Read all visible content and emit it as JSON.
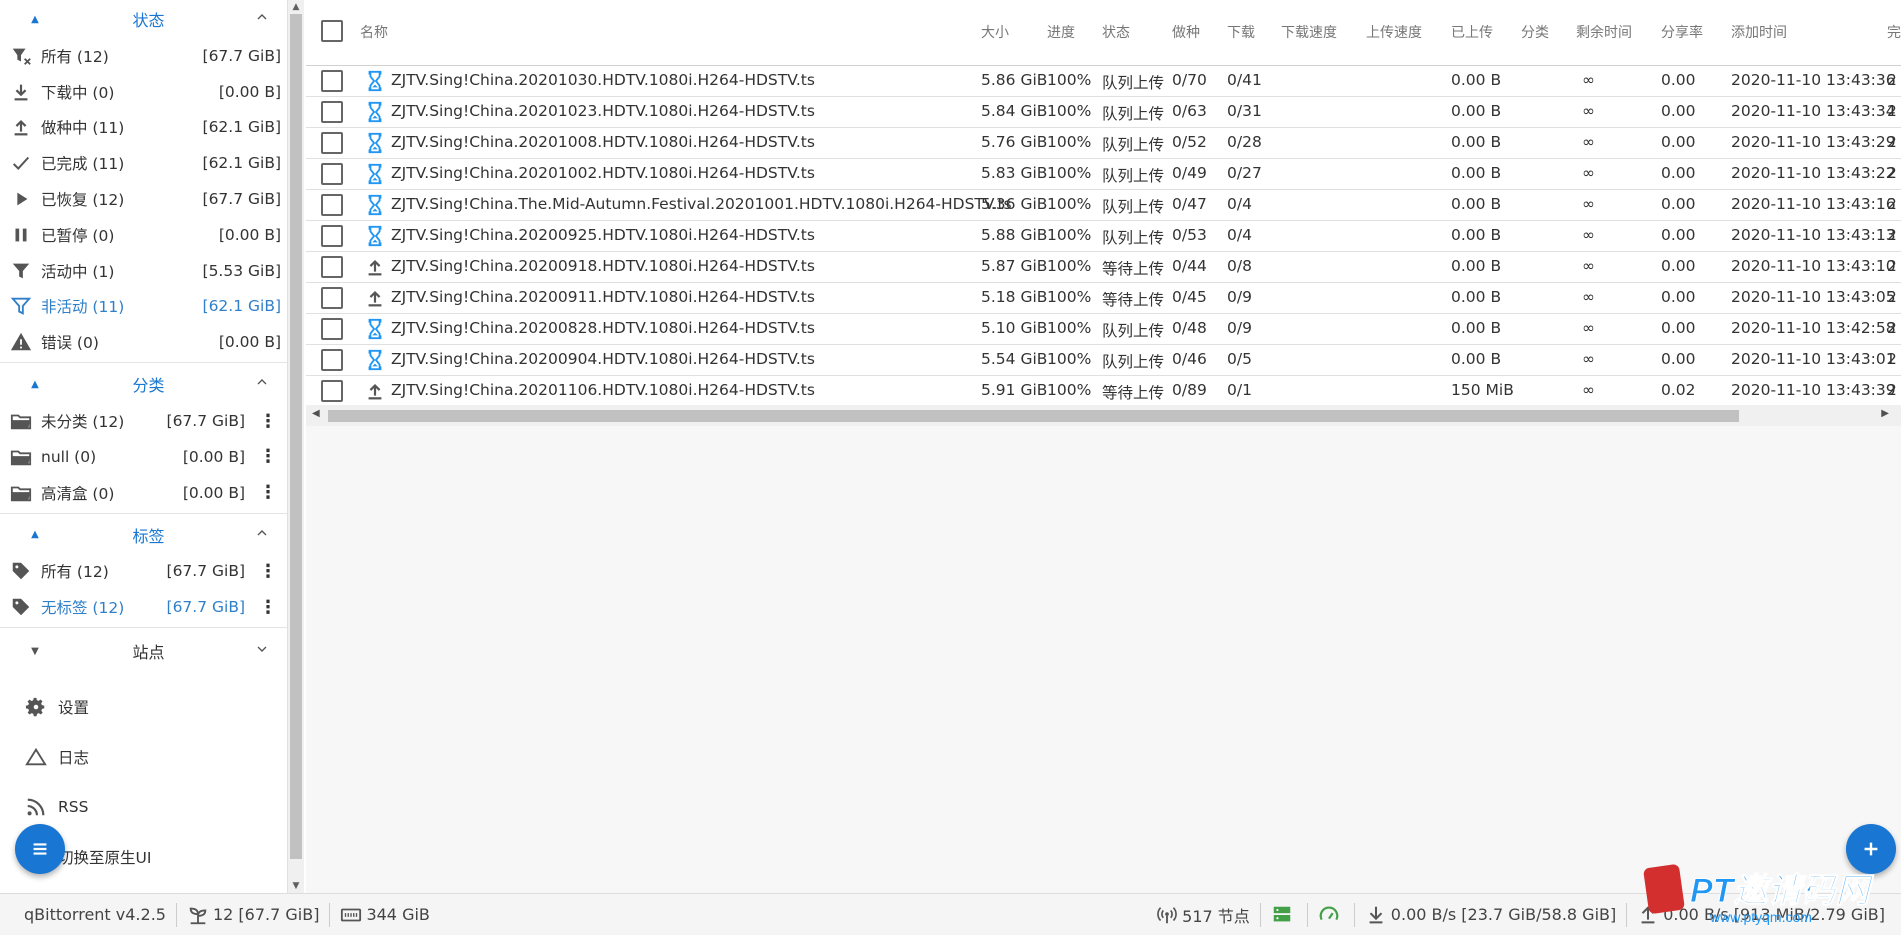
{
  "sidebar": {
    "status_section": {
      "title": "状态",
      "items": [
        {
          "label": "所有 (12)",
          "value": "[67.7 GiB]",
          "icon": "filter-x-icon"
        },
        {
          "label": "下载中 (0)",
          "value": "[0.00 B]",
          "icon": "download-icon"
        },
        {
          "label": "做种中 (11)",
          "value": "[62.1 GiB]",
          "icon": "upload-icon"
        },
        {
          "label": "已完成 (11)",
          "value": "[62.1 GiB]",
          "icon": "check-icon"
        },
        {
          "label": "已恢复 (12)",
          "value": "[67.7 GiB]",
          "icon": "play-icon"
        },
        {
          "label": "已暂停 (0)",
          "value": "[0.00 B]",
          "icon": "pause-icon"
        },
        {
          "label": "活动中 (1)",
          "value": "[5.53 GiB]",
          "icon": "filter-icon"
        },
        {
          "label": "非活动 (11)",
          "value": "[62.1 GiB]",
          "icon": "filter-outline-icon"
        },
        {
          "label": "错误 (0)",
          "value": "[0.00 B]",
          "icon": "alert-icon"
        }
      ]
    },
    "category_section": {
      "title": "分类",
      "items": [
        {
          "label": "未分类 (12)",
          "value": "[67.7 GiB]"
        },
        {
          "label": "null (0)",
          "value": "[0.00 B]"
        },
        {
          "label": "高清盒 (0)",
          "value": "[0.00 B]"
        }
      ]
    },
    "tag_section": {
      "title": "标签",
      "items": [
        {
          "label": "所有 (12)",
          "value": "[67.7 GiB]"
        },
        {
          "label": "无标签 (12)",
          "value": "[67.7 GiB]"
        }
      ]
    },
    "site_section": {
      "title": "站点"
    },
    "nav": [
      {
        "label": "设置",
        "icon": "gear-icon"
      },
      {
        "label": "日志",
        "icon": "triangle-icon"
      },
      {
        "label": "RSS",
        "icon": "rss-icon"
      },
      {
        "label": "切换至原生UI",
        "icon": "swap-icon"
      }
    ]
  },
  "table": {
    "headers": {
      "name": "名称",
      "size": "大小",
      "progress": "进度",
      "state": "状态",
      "seeds": "做种",
      "peers": "下载",
      "dl_speed": "下载速度",
      "up_speed": "上传速度",
      "uploaded": "已上传",
      "category": "分类",
      "eta": "剩余时间",
      "ratio": "分享率",
      "added": "添加时间",
      "more": "完"
    },
    "rows": [
      {
        "icon": "hourglass-icon",
        "name": "ZJTV.Sing!China.20201030.HDTV.1080i.H264-HDSTV.ts",
        "size": "5.86 GiB",
        "progress": "100%",
        "state": "队列上传",
        "seeds": "0/70",
        "peers": "0/41",
        "uploaded": "0.00 B",
        "eta": "∞",
        "ratio": "0.00",
        "added": "2020-11-10 13:43:36",
        "extra": "2"
      },
      {
        "icon": "hourglass-icon",
        "name": "ZJTV.Sing!China.20201023.HDTV.1080i.H264-HDSTV.ts",
        "size": "5.84 GiB",
        "progress": "100%",
        "state": "队列上传",
        "seeds": "0/63",
        "peers": "0/31",
        "uploaded": "0.00 B",
        "eta": "∞",
        "ratio": "0.00",
        "added": "2020-11-10 13:43:34",
        "extra": "2"
      },
      {
        "icon": "hourglass-icon",
        "name": "ZJTV.Sing!China.20201008.HDTV.1080i.H264-HDSTV.ts",
        "size": "5.76 GiB",
        "progress": "100%",
        "state": "队列上传",
        "seeds": "0/52",
        "peers": "0/28",
        "uploaded": "0.00 B",
        "eta": "∞",
        "ratio": "0.00",
        "added": "2020-11-10 13:43:29",
        "extra": "2"
      },
      {
        "icon": "hourglass-icon",
        "name": "ZJTV.Sing!China.20201002.HDTV.1080i.H264-HDSTV.ts",
        "size": "5.83 GiB",
        "progress": "100%",
        "state": "队列上传",
        "seeds": "0/49",
        "peers": "0/27",
        "uploaded": "0.00 B",
        "eta": "∞",
        "ratio": "0.00",
        "added": "2020-11-10 13:43:22",
        "extra": "2"
      },
      {
        "icon": "hourglass-icon",
        "name": "ZJTV.Sing!China.The.Mid-Autumn.Festival.20201001.HDTV.1080i.H264-HDSTV.ts",
        "size": "5.36 GiB",
        "progress": "100%",
        "state": "队列上传",
        "seeds": "0/47",
        "peers": "0/4",
        "uploaded": "0.00 B",
        "eta": "∞",
        "ratio": "0.00",
        "added": "2020-11-10 13:43:16",
        "extra": "2"
      },
      {
        "icon": "hourglass-icon",
        "name": "ZJTV.Sing!China.20200925.HDTV.1080i.H264-HDSTV.ts",
        "size": "5.88 GiB",
        "progress": "100%",
        "state": "队列上传",
        "seeds": "0/53",
        "peers": "0/4",
        "uploaded": "0.00 B",
        "eta": "∞",
        "ratio": "0.00",
        "added": "2020-11-10 13:43:13",
        "extra": "2"
      },
      {
        "icon": "upload-icon",
        "name": "ZJTV.Sing!China.20200918.HDTV.1080i.H264-HDSTV.ts",
        "size": "5.87 GiB",
        "progress": "100%",
        "state": "等待上传",
        "seeds": "0/44",
        "peers": "0/8",
        "uploaded": "0.00 B",
        "eta": "∞",
        "ratio": "0.00",
        "added": "2020-11-10 13:43:10",
        "extra": "2"
      },
      {
        "icon": "upload-icon",
        "name": "ZJTV.Sing!China.20200911.HDTV.1080i.H264-HDSTV.ts",
        "size": "5.18 GiB",
        "progress": "100%",
        "state": "等待上传",
        "seeds": "0/45",
        "peers": "0/9",
        "uploaded": "0.00 B",
        "eta": "∞",
        "ratio": "0.00",
        "added": "2020-11-10 13:43:05",
        "extra": "2"
      },
      {
        "icon": "hourglass-icon",
        "name": "ZJTV.Sing!China.20200828.HDTV.1080i.H264-HDSTV.ts",
        "size": "5.10 GiB",
        "progress": "100%",
        "state": "队列上传",
        "seeds": "0/48",
        "peers": "0/9",
        "uploaded": "0.00 B",
        "eta": "∞",
        "ratio": "0.00",
        "added": "2020-11-10 13:42:58",
        "extra": "2"
      },
      {
        "icon": "hourglass-icon",
        "name": "ZJTV.Sing!China.20200904.HDTV.1080i.H264-HDSTV.ts",
        "size": "5.54 GiB",
        "progress": "100%",
        "state": "队列上传",
        "seeds": "0/46",
        "peers": "0/5",
        "uploaded": "0.00 B",
        "eta": "∞",
        "ratio": "0.00",
        "added": "2020-11-10 13:43:01",
        "extra": "2"
      },
      {
        "icon": "upload-icon",
        "name": "ZJTV.Sing!China.20201106.HDTV.1080i.H264-HDSTV.ts",
        "size": "5.91 GiB",
        "progress": "100%",
        "state": "等待上传",
        "seeds": "0/89",
        "peers": "0/1",
        "uploaded": "150 MiB",
        "eta": "∞",
        "ratio": "0.02",
        "added": "2020-11-10 13:43:39",
        "extra": "2"
      }
    ]
  },
  "statusbar": {
    "app_version": "qBittorrent v4.2.5",
    "torrents": "12 [67.7 GiB]",
    "free_space": "344 GiB",
    "nodes": "517 节点",
    "download": "0.00 B/s [23.7 GiB/58.8 GiB]",
    "upload": "0.00 B/s [913 MiB/2.79 GiB]"
  },
  "watermark": {
    "text": "PT邀请码网",
    "url": "www.ptyqm.com"
  },
  "colors": {
    "accent": "#1976d2",
    "active_text": "#2f7fc9",
    "hourglass": "#2196f3"
  }
}
